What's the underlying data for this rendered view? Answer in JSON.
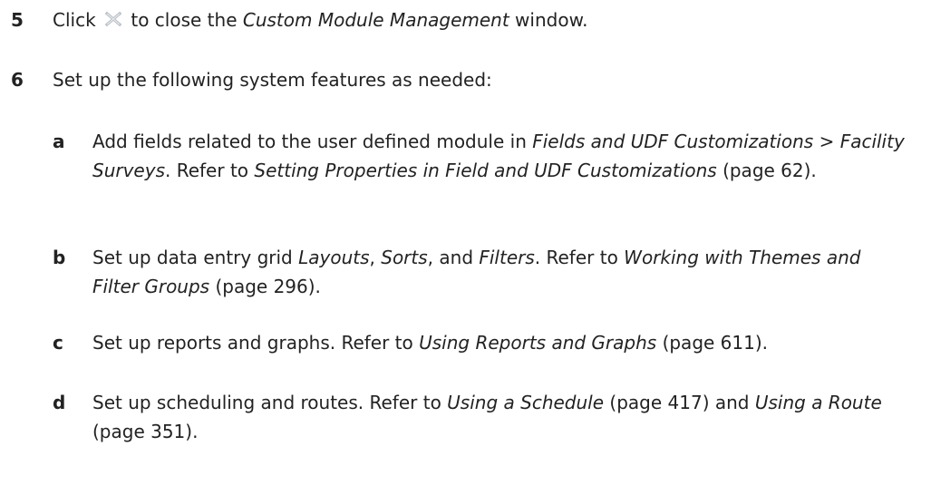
{
  "step5": {
    "num": "5",
    "pre": "Click",
    "icon": "close-icon",
    "mid": "to close the",
    "window": "Custom Module Management",
    "post": "window."
  },
  "step6": {
    "num": "6",
    "text": "Set up the following system features as needed:"
  },
  "sub_a": {
    "letter": "a",
    "t1": "Add fields related to the user defined module in",
    "i1": "Fields and UDF Customizations",
    "sep": ">",
    "i2": "Facility Surveys",
    "t2": ". Refer to",
    "i3": "Setting Properties in Field and UDF Customizations",
    "page": "(page 62)."
  },
  "sub_b": {
    "letter": "b",
    "t1": "Set up data entry grid",
    "i1": "Layouts",
    "c1": ",",
    "i2": "Sorts",
    "c2": ", and",
    "i3": "Filters",
    "t2": ". Refer to",
    "i4": "Working with Themes and Filter Groups",
    "page": "(page 296)."
  },
  "sub_c": {
    "letter": "c",
    "t1": "Set up reports and graphs. Refer to",
    "i1": "Using Reports and Graphs",
    "page": "(page 611)."
  },
  "sub_d": {
    "letter": "d",
    "t1": "Set up scheduling and routes. Refer to",
    "i1": "Using a Schedule",
    "page1": "(page 417) and",
    "i2": "Using a Route",
    "page2": "(page 351)."
  }
}
